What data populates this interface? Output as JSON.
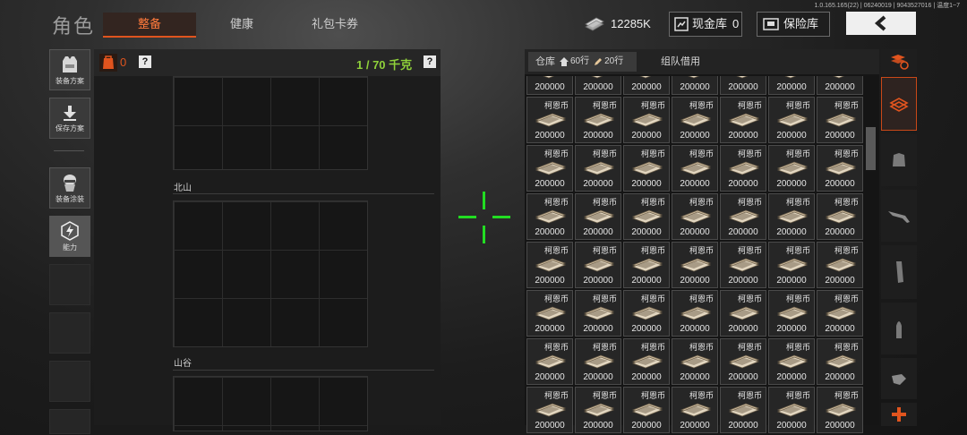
{
  "version_text": "1.0.165.165(22) | 06240019 | 9043527016 | 温度1~7",
  "page_title": "角色",
  "tabs": [
    {
      "label": "整备",
      "active": true
    },
    {
      "label": "健康",
      "active": false
    },
    {
      "label": "礼包卡券",
      "active": false
    }
  ],
  "header": {
    "currency_amount": "12285K",
    "cash_vault_label": "现金库",
    "cash_vault_count": "0",
    "safe_label": "保险库"
  },
  "sidebar": {
    "items": [
      {
        "label": "装备方案"
      },
      {
        "label": "保存方案"
      },
      {
        "label": "装备涂装"
      },
      {
        "label": "能力"
      }
    ]
  },
  "loadout": {
    "backpack_count": "0",
    "weight": "1 / 70 千克",
    "sections": [
      "北山",
      "山谷"
    ]
  },
  "warehouse": {
    "tab_label": "仓库",
    "slots_a": "60行",
    "slots_b": "20行",
    "team_tab": "组队借用",
    "item_name": "柯恩币",
    "item_amount": "200000"
  },
  "colors": {
    "accent": "#e0541e",
    "weight_green": "#8fd13a",
    "crosshair": "#22dd22"
  }
}
